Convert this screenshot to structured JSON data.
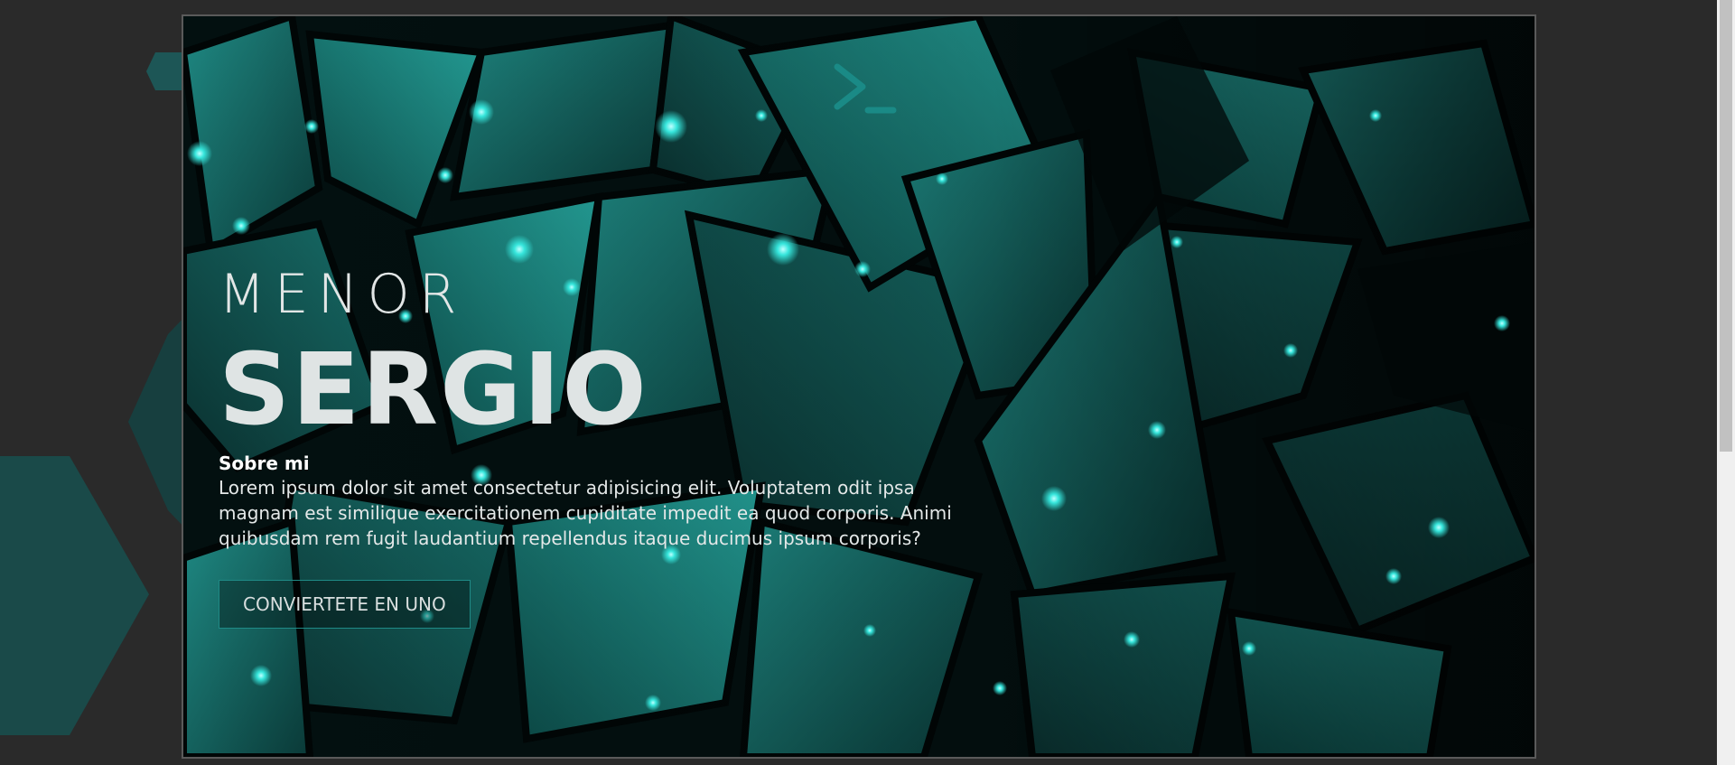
{
  "hero": {
    "subtitle": "MENOR",
    "title": "SERGIO",
    "about_heading": "Sobre mi",
    "about_text": "Lorem ipsum dolor sit amet consectetur adipisicing elit. Voluptatem odit ipsa magnam est similique exercitationem cupiditate impedit ea quod corporis. Animi quibusdam rem fugit laudantium repellendus itaque ducimus ipsum corporis?",
    "cta_label": "CONVIERTETE EN UNO"
  },
  "icons": {
    "logo": "terminal-prompt-icon"
  },
  "colors": {
    "page_background": "#2a2a2a",
    "accent": "#1a8a86",
    "hexagon": "#1a4a49",
    "hero_border": "#5a5a5a",
    "text": "#e2e6e6"
  }
}
